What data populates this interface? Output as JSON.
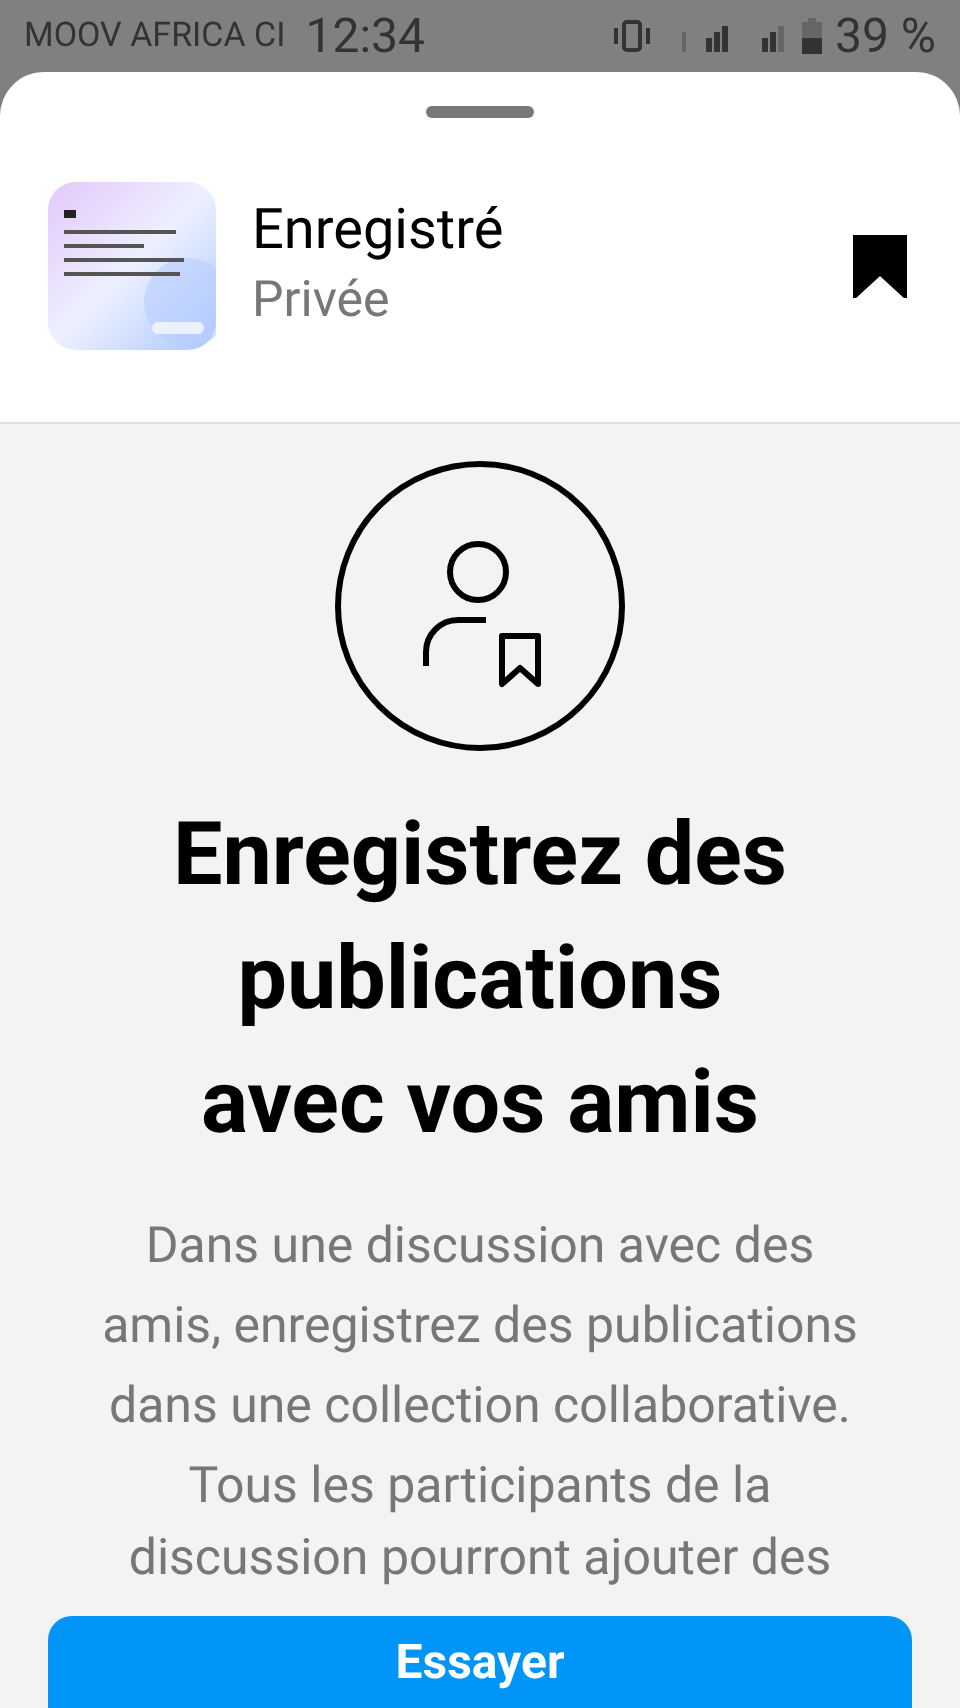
{
  "status_bar": {
    "carrier": "MOOV AFRICA CI",
    "time": "12:34",
    "battery": "39 %"
  },
  "header": {
    "title": "Enregistré",
    "subtitle": "Privée",
    "saved": true
  },
  "empty_state": {
    "heading": "Enregistrez des publications avec vos amis",
    "description_lines": [
      "Dans une discussion avec des",
      "amis, enregistrez des publications",
      "dans une collection collaborative.",
      "Tous les participants de la"
    ],
    "cut_line": "discussion pourront ajouter des",
    "button": "Essayer"
  }
}
